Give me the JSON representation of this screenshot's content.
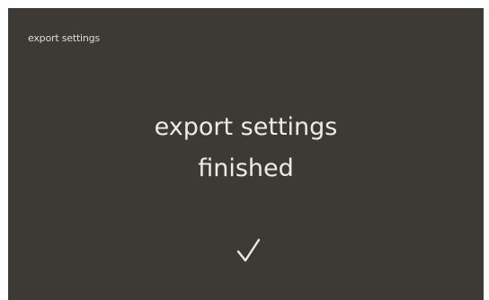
{
  "screen": {
    "title": "export settings",
    "message_line1": "export settings",
    "message_line2": "finished",
    "status_icon": "checkmark-icon"
  },
  "colors": {
    "background": "#3d3a36",
    "text": "#eeebe6"
  }
}
